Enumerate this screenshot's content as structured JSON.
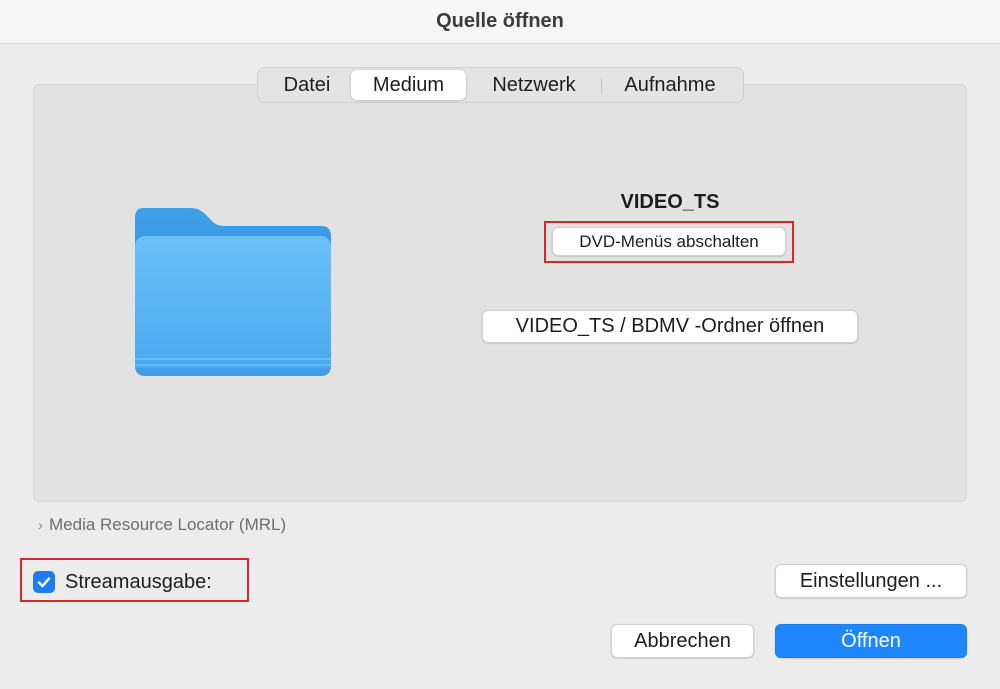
{
  "window": {
    "title": "Quelle öffnen"
  },
  "tabs": [
    {
      "label": "Datei"
    },
    {
      "label": "Medium"
    },
    {
      "label": "Netzwerk"
    },
    {
      "label": "Aufnahme"
    }
  ],
  "active_tab": "Medium",
  "disc": {
    "name": "VIDEO_TS",
    "disable_menus_label": "DVD-Menüs abschalten",
    "open_folder_label": "VIDEO_TS / BDMV -Ordner öffnen",
    "icon": "folder-icon",
    "folder_color": "#4fb0f4"
  },
  "mrl": {
    "label": "Media Resource Locator (MRL)",
    "icon": "chevron-right-icon"
  },
  "stream_output": {
    "label": "Streamausgabe:",
    "checked": true
  },
  "buttons": {
    "settings": "Einstellungen ...",
    "cancel": "Abbrechen",
    "open": "Öffnen"
  },
  "colors": {
    "accent": "#1f87fd",
    "highlight": "#d9262c"
  }
}
